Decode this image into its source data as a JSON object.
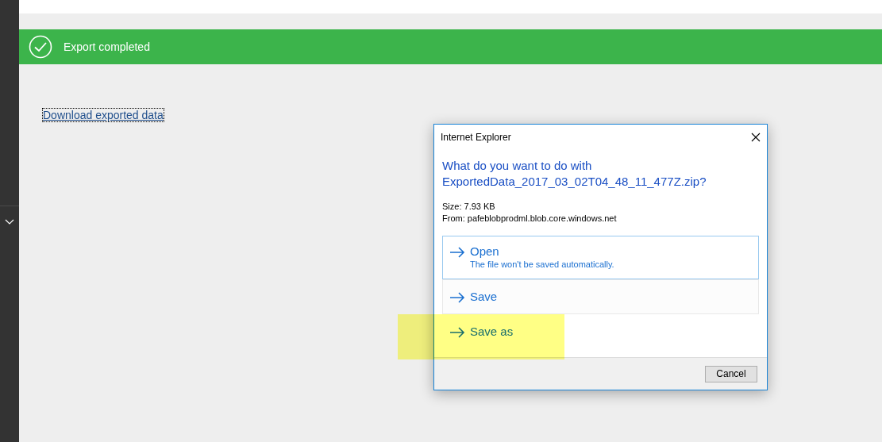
{
  "banner": {
    "message": "Export completed"
  },
  "link": "Download exported data",
  "dialog": {
    "title": "Internet Explorer",
    "question": "What do you want to do with ExportedData_2017_03_02T04_48_11_477Z.zip?",
    "details": [
      "Size: 7.93 KB",
      "From: pafeblobprodml.blob.core.windows.net"
    ],
    "options": [
      {
        "label": "Open",
        "note": "The file won't be saved automatically.",
        "focused": true,
        "hovered": false,
        "highlighted": false
      },
      {
        "label": "Save",
        "focused": false,
        "hovered": true,
        "highlighted": false
      },
      {
        "label": "Save as",
        "focused": false,
        "hovered": false,
        "highlighted": true
      }
    ],
    "cancel": "Cancel"
  }
}
